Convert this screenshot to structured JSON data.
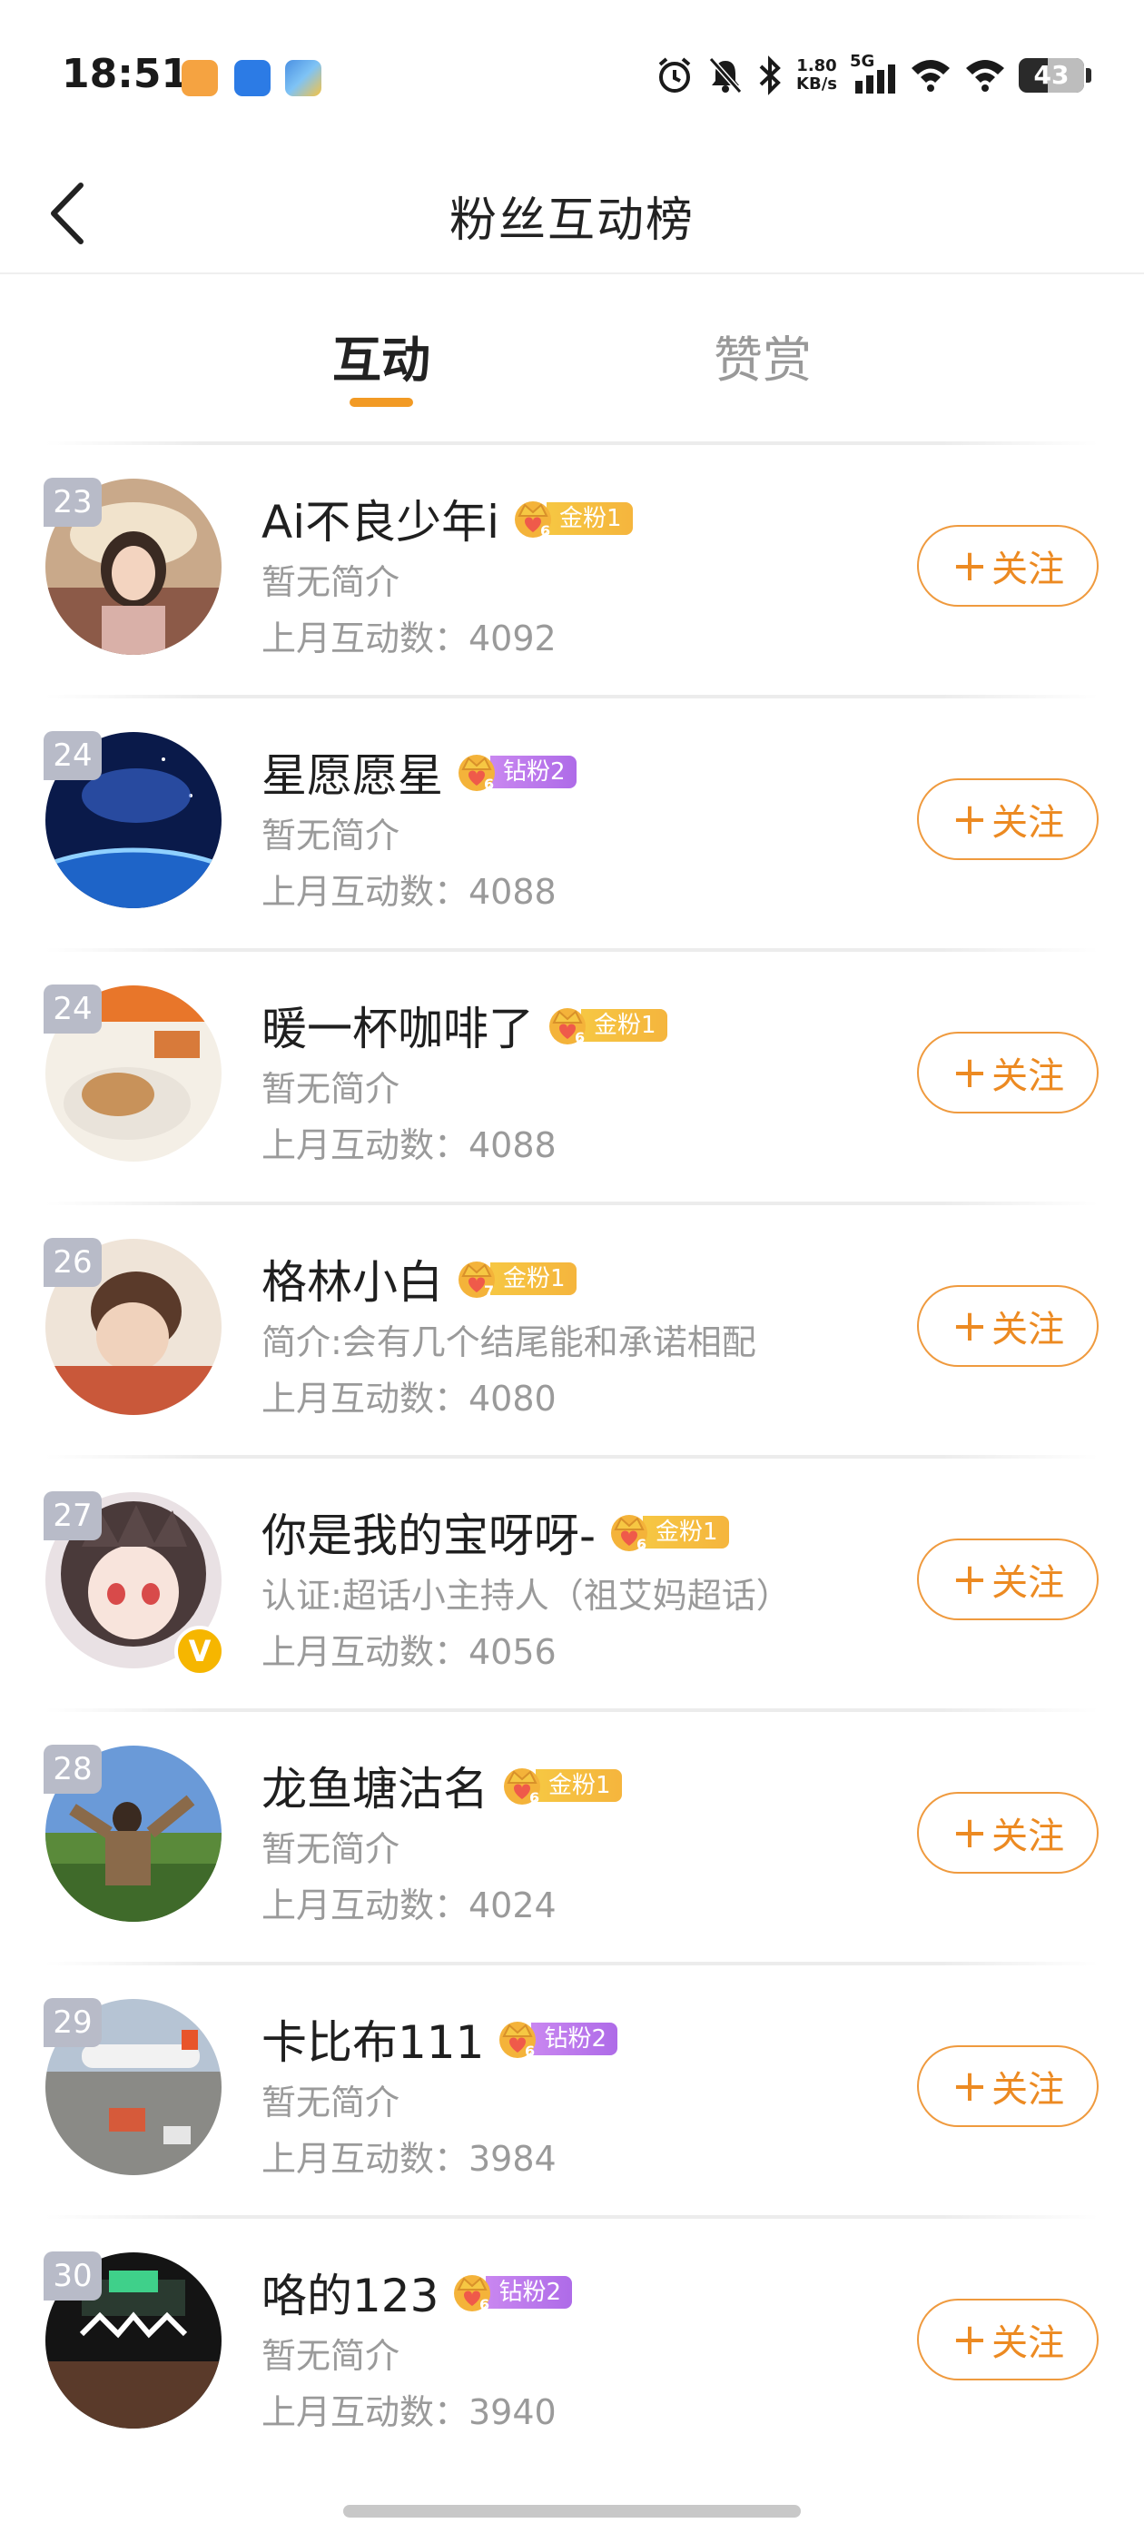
{
  "status_bar": {
    "time": "18:51",
    "net_speed_value": "1.80",
    "net_speed_unit": "KB/s",
    "network": "5G",
    "battery": "43",
    "icons": [
      "app-orange-icon",
      "app-blue-icon",
      "app-multicolor-icon",
      "alarm-icon",
      "mute-icon",
      "bluetooth-icon",
      "signal-icon",
      "wifi-icon",
      "wifi-icon",
      "battery-icon"
    ]
  },
  "header": {
    "back_icon": "chevron-left-icon",
    "title": "粉丝互动榜"
  },
  "tabs": [
    {
      "label": "互动",
      "active": true
    },
    {
      "label": "赞赏",
      "active": false
    }
  ],
  "colors": {
    "accent": "#ec8a22",
    "rank_badge": "#b8bbc8",
    "gold_badge": "#f5b53d",
    "diamond_badge": "#ae6be8"
  },
  "rows": [
    {
      "rank": "23",
      "name": "Ai不良少年i",
      "level": "6",
      "badge": "金粉1",
      "badge_type": "gold",
      "bio": "暂无简介",
      "interact": "上月互动数：4092",
      "follow": "关注",
      "avatar": "avatar-girl-hat",
      "verified": false
    },
    {
      "rank": "24",
      "name": "星愿愿星",
      "level": "6",
      "badge": "钻粉2",
      "badge_type": "diamond",
      "bio": "暂无简介",
      "interact": "上月互动数：4088",
      "follow": "关注",
      "avatar": "avatar-space-earth",
      "verified": false
    },
    {
      "rank": "24",
      "name": "暖一杯咖啡了",
      "level": "6",
      "badge": "金粉1",
      "badge_type": "gold",
      "bio": "暂无简介",
      "interact": "上月互动数：4088",
      "follow": "关注",
      "avatar": "avatar-coffee",
      "verified": false
    },
    {
      "rank": "26",
      "name": "格林小白",
      "level": "7",
      "badge": "金粉1",
      "badge_type": "gold",
      "bio": "简介:会有几个结尾能和承诺相配",
      "interact": "上月互动数：4080",
      "follow": "关注",
      "avatar": "avatar-sleeping-boy",
      "verified": false
    },
    {
      "rank": "27",
      "name": "你是我的宝呀呀-",
      "level": "6",
      "badge": "金粉1",
      "badge_type": "gold",
      "bio": "认证:超话小主持人（祖艾妈超话）",
      "interact": "上月互动数：4056",
      "follow": "关注",
      "avatar": "avatar-anime-girl",
      "verified": true,
      "verified_mark": "V"
    },
    {
      "rank": "28",
      "name": "龙鱼塘沽名",
      "level": "6",
      "badge": "金粉1",
      "badge_type": "gold",
      "bio": "暂无简介",
      "interact": "上月互动数：4024",
      "follow": "关注",
      "avatar": "avatar-person-field",
      "verified": false
    },
    {
      "rank": "29",
      "name": "卡比布111",
      "level": "6",
      "badge": "钻粉2",
      "badge_type": "diamond",
      "bio": "暂无简介",
      "interact": "上月互动数：3984",
      "follow": "关注",
      "avatar": "avatar-airport",
      "verified": false
    },
    {
      "rank": "30",
      "name": "咯的123",
      "level": "6",
      "badge": "钻粉2",
      "badge_type": "diamond",
      "bio": "暂无简介",
      "interact": "上月互动数：3940",
      "follow": "关注",
      "avatar": "avatar-concert",
      "verified": false
    }
  ]
}
